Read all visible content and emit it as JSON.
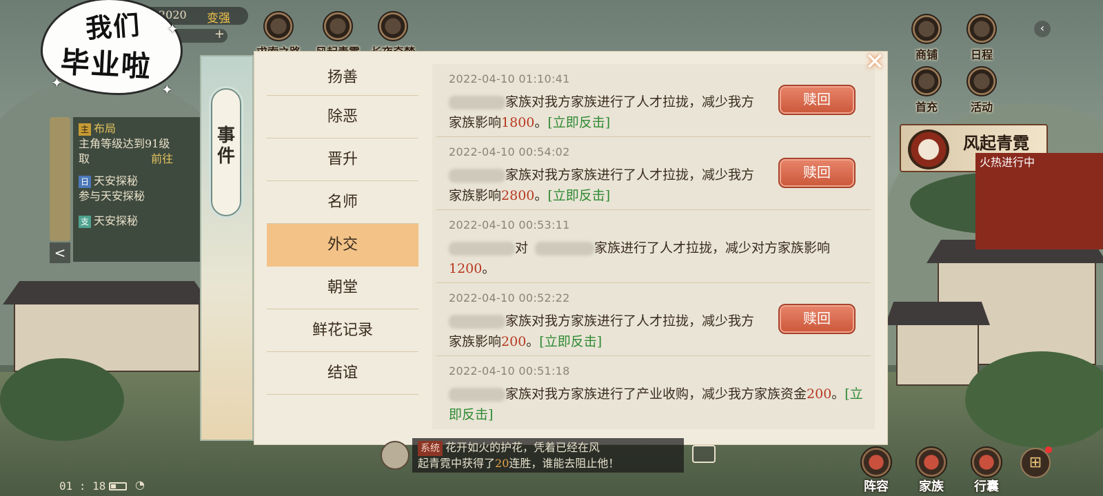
{
  "sticker": {
    "line1": "我们",
    "line2": "毕业啦"
  },
  "top_bar": {
    "resource_value": "2020",
    "power_button": "变强",
    "plus": "+",
    "left_icons": [
      {
        "label": "求索之路",
        "icon": "scroll-icon"
      },
      {
        "label": "风起青霓",
        "icon": "drum-icon"
      },
      {
        "label": "长夜奇梦",
        "icon": "moon-icon"
      }
    ],
    "right_icons": [
      {
        "label": "商铺",
        "icon": "shop-icon"
      },
      {
        "label": "日程",
        "icon": "calendar-icon"
      },
      {
        "label": "首充",
        "icon": "first-charge-icon"
      },
      {
        "label": "活动",
        "icon": "activity-icon"
      }
    ],
    "collapse_arrow": "‹"
  },
  "banner": {
    "title": "风起青霓",
    "subtitle": "火热进行中"
  },
  "quest_panel": {
    "items": [
      {
        "tag": "主",
        "title": "布局",
        "desc": "主角等级达到91级",
        "action_prefix": "取",
        "action": "前往"
      },
      {
        "tag": "日",
        "title": "天安探秘",
        "desc": "参与天安探秘"
      },
      {
        "tag": "支",
        "title": "天安探秘"
      }
    ],
    "collapse": "<"
  },
  "dialog": {
    "side_title": [
      "事",
      "件"
    ],
    "close": "✕",
    "nav": [
      {
        "label": "扬善",
        "active": false
      },
      {
        "label": "除恶",
        "active": false
      },
      {
        "label": "晋升",
        "active": false
      },
      {
        "label": "名师",
        "active": false
      },
      {
        "label": "外交",
        "active": true
      },
      {
        "label": "朝堂",
        "active": false
      },
      {
        "label": "鲜花记录",
        "active": false
      },
      {
        "label": "结谊",
        "active": false
      }
    ],
    "events": [
      {
        "time": "2022-04-10 01:10:41",
        "text_a": "家族对我方家族进行了人才拉拢，减少我方家族影响",
        "number": "1800",
        "text_b": "。",
        "link": "[立即反击]",
        "button": "赎回"
      },
      {
        "time": "2022-04-10 00:54:02",
        "text_a": "家族对我方家族进行了人才拉拢，减少我方家族影响",
        "number": "2800",
        "text_b": "。",
        "link": "[立即反击]",
        "button": "赎回"
      },
      {
        "time": "2022-04-10 00:53:11",
        "text_pre": "对",
        "text_a": "家族进行了人才拉拢，减少对方家族影响",
        "number": "1200",
        "text_b": "。"
      },
      {
        "time": "2022-04-10 00:52:22",
        "text_a": "家族对我方家族进行了人才拉拢，减少我方家族影响",
        "number": "200",
        "text_b": "。",
        "link": "[立即反击]",
        "button": "赎回"
      },
      {
        "time": "2022-04-10 00:51:18",
        "text_a": "家族对我方家族进行了产业收购，减少我方家族资金",
        "number": "200",
        "text_b": "。",
        "link": "[立即反击]"
      }
    ]
  },
  "chat": {
    "tag": "系统",
    "line1": "花开如火的护花，凭着已经在风",
    "line2_a": "起青霓中获得了",
    "highlight": "20",
    "line2_b": "连胜，谁能去阻止他！"
  },
  "status": {
    "clock": "01 : 18",
    "wifi": "📶"
  },
  "bottom_icons": [
    {
      "label": "阵容",
      "icon": "formation-icon"
    },
    {
      "label": "家族",
      "icon": "clan-icon"
    },
    {
      "label": "行囊",
      "icon": "bag-icon"
    }
  ],
  "grid_button": "⊞"
}
